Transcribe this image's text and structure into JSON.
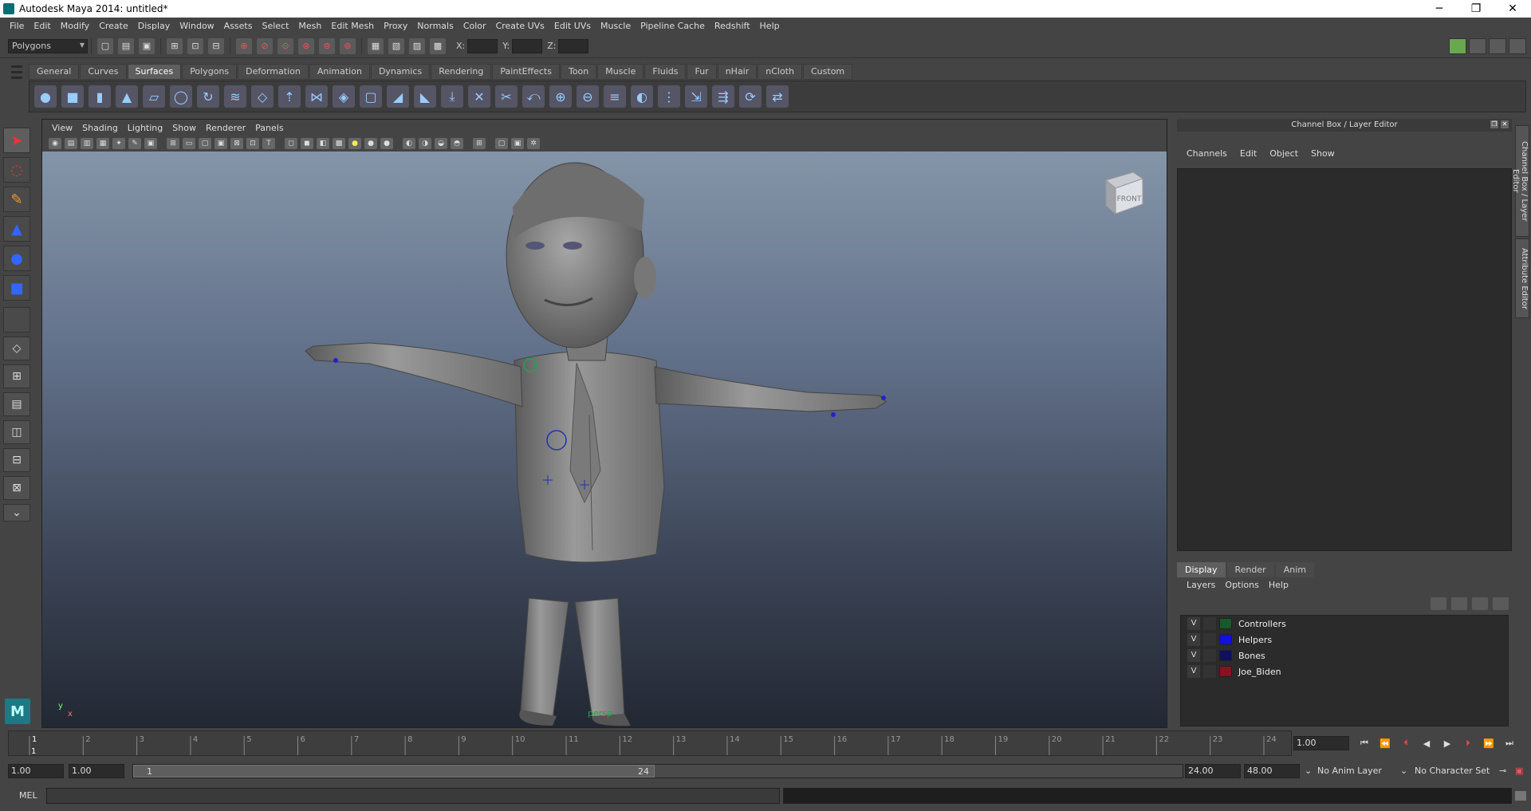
{
  "window": {
    "title": "Autodesk Maya 2014: untitled*",
    "buttons": [
      "─",
      "❐",
      "✕"
    ]
  },
  "menubar": [
    "File",
    "Edit",
    "Modify",
    "Create",
    "Display",
    "Window",
    "Assets",
    "Select",
    "Mesh",
    "Edit Mesh",
    "Proxy",
    "Normals",
    "Color",
    "Create UVs",
    "Edit UVs",
    "Muscle",
    "Pipeline Cache",
    "Redshift",
    "Help"
  ],
  "statusline": {
    "mode": "Polygons",
    "x_label": "X:",
    "y_label": "Y:",
    "z_label": "Z:",
    "x_value": "",
    "y_value": "",
    "z_value": ""
  },
  "shelf": {
    "tabs": [
      "General",
      "Curves",
      "Surfaces",
      "Polygons",
      "Deformation",
      "Animation",
      "Dynamics",
      "Rendering",
      "PaintEffects",
      "Toon",
      "Muscle",
      "Fluids",
      "Fur",
      "nHair",
      "nCloth",
      "Custom"
    ],
    "active_tab": "Surfaces",
    "icons": [
      "sphere",
      "cube",
      "cylinder",
      "cone",
      "plane",
      "torus",
      "revolve",
      "loft",
      "planar",
      "extrude",
      "birail",
      "boundary",
      "square",
      "bevel",
      "bevel-plus",
      "project-curve",
      "intersect",
      "trim",
      "untrim",
      "attach",
      "detach",
      "align",
      "open-close",
      "insert-isoparm",
      "extend",
      "offset",
      "rebuild",
      "reverse"
    ]
  },
  "viewport": {
    "menu": [
      "View",
      "Shading",
      "Lighting",
      "Show",
      "Renderer",
      "Panels"
    ],
    "camera_label": "persp",
    "viewcube_label": "FRONT",
    "axis_x": "x",
    "axis_y": "y"
  },
  "channel_box": {
    "title": "Channel Box / Layer Editor",
    "menu": [
      "Channels",
      "Edit",
      "Object",
      "Show"
    ]
  },
  "layer_editor": {
    "tabs": [
      "Display",
      "Render",
      "Anim"
    ],
    "active_tab": "Display",
    "menu": [
      "Layers",
      "Options",
      "Help"
    ],
    "layers": [
      {
        "visibility": "V",
        "name": "Controllers",
        "color": "#145a2a"
      },
      {
        "visibility": "V",
        "name": "Helpers",
        "color": "#1010e0"
      },
      {
        "visibility": "V",
        "name": "Bones",
        "color": "#101060"
      },
      {
        "visibility": "V",
        "name": "Joe_Biden",
        "color": "#8a1022"
      }
    ]
  },
  "side_tabs": [
    "Channel Box / Layer Editor",
    "Attribute Editor"
  ],
  "timeline": {
    "ticks": [
      1,
      2,
      3,
      4,
      5,
      6,
      7,
      8,
      9,
      10,
      11,
      12,
      13,
      14,
      15,
      16,
      17,
      18,
      19,
      20,
      21,
      22,
      23,
      24
    ],
    "current_frame": "1.00"
  },
  "range": {
    "start_time": "1.00",
    "start_playback": "1.00",
    "handle_start": "1",
    "handle_end": "24",
    "end_playback": "24.00",
    "end_time": "48.00",
    "anim_layer": "No Anim Layer",
    "character_set": "No Character Set"
  },
  "command_line": {
    "label": "MEL",
    "value": ""
  },
  "colors": {
    "ui_bg": "#444444",
    "field_bg": "#2b2b2b",
    "viewport_top": "#8595a8",
    "viewport_bottom": "#222833",
    "accent_red": "#e04040"
  }
}
